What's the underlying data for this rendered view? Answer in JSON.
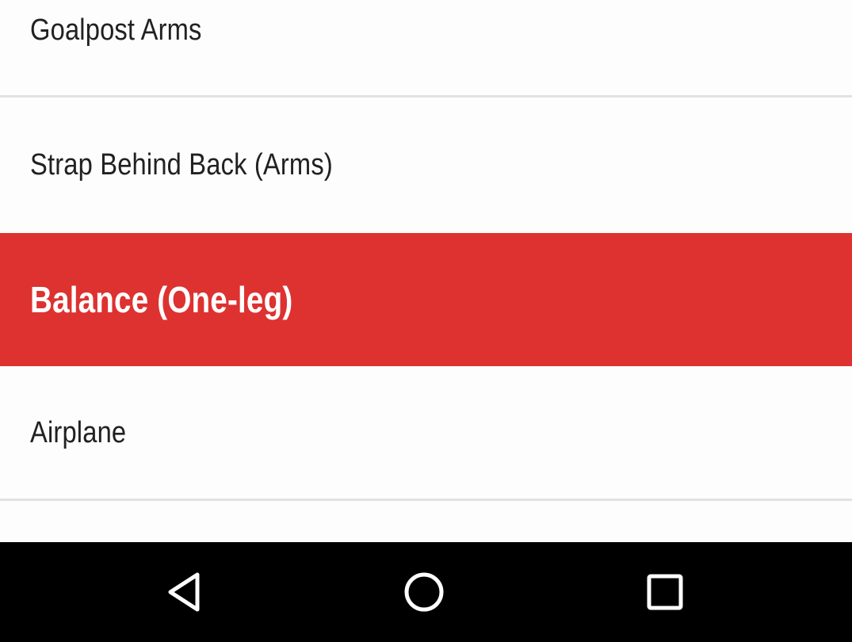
{
  "list": {
    "items": [
      {
        "label": "Goalpost Arms",
        "selected": false
      },
      {
        "label": "Strap Behind Back (Arms)",
        "selected": false
      },
      {
        "label": "Balance (One-leg)",
        "selected": true
      },
      {
        "label": "Airplane",
        "selected": false
      }
    ]
  },
  "colors": {
    "selected_background": "#dd3230",
    "selected_text": "#ffffff",
    "text": "#212121",
    "background": "#fdfdfd",
    "divider": "#e2e2e2",
    "navbar": "#000000"
  },
  "navbar": {
    "buttons": [
      {
        "icon": "back-icon"
      },
      {
        "icon": "home-icon"
      },
      {
        "icon": "recents-icon"
      }
    ]
  }
}
